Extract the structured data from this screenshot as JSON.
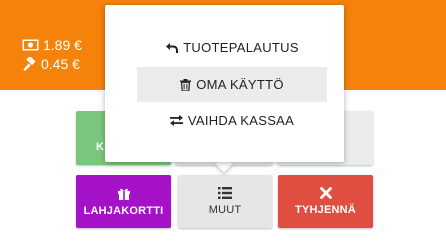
{
  "header": {
    "cash_amount": "1.89 €",
    "hammer_amount": "0.45 €",
    "cash_icon": "money-bill-icon",
    "hammer_icon": "gavel-icon",
    "color": "#f5820b"
  },
  "buttons": {
    "green_label": "KA",
    "gift_card_label": "LAHJAKORTTI",
    "more_label": "MUUT",
    "clear_label": "TYHJENNÄ"
  },
  "popup_menu": {
    "items": [
      {
        "label": "TUOTEPALAUTUS",
        "icon": "undo-icon"
      },
      {
        "label": "OMA KÄYTTÖ",
        "icon": "trash-icon",
        "selected": true
      },
      {
        "label": "VAIHDA KASSAA",
        "icon": "exchange-icon"
      }
    ]
  },
  "colors": {
    "green": "#7cc57c",
    "purple": "#a411c6",
    "red": "#e04e41",
    "grey": "#e6e6e6"
  }
}
